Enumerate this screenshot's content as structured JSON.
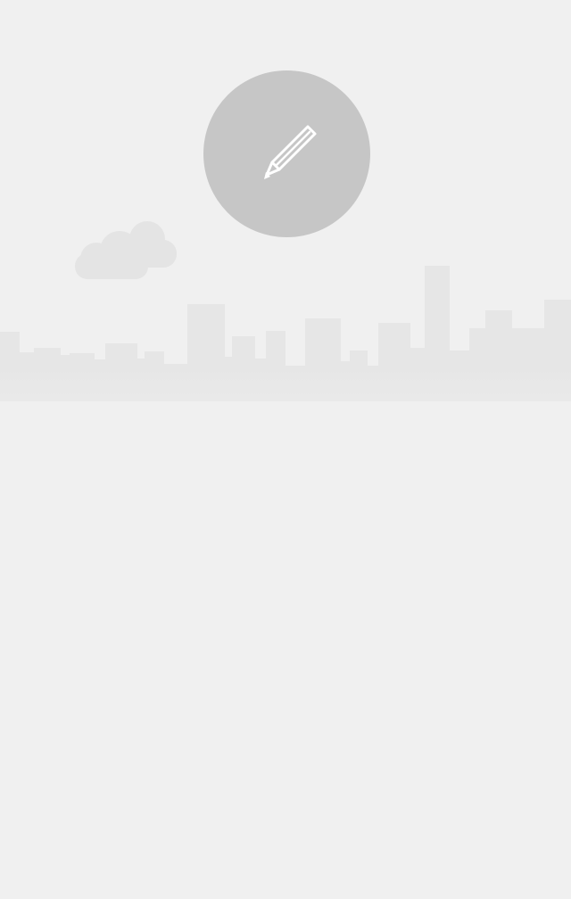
{
  "screen": {
    "name": "empty-state-illustration"
  },
  "edit_button": {
    "icon": "pencil-icon",
    "circle_color": "#c6c6c6",
    "icon_color": "#ffffff"
  },
  "illustration": {
    "elements": [
      "cloud-icon",
      "city-skyline"
    ],
    "tint": "#e6e6e6"
  },
  "colors": {
    "background": "#f0f0f0"
  }
}
